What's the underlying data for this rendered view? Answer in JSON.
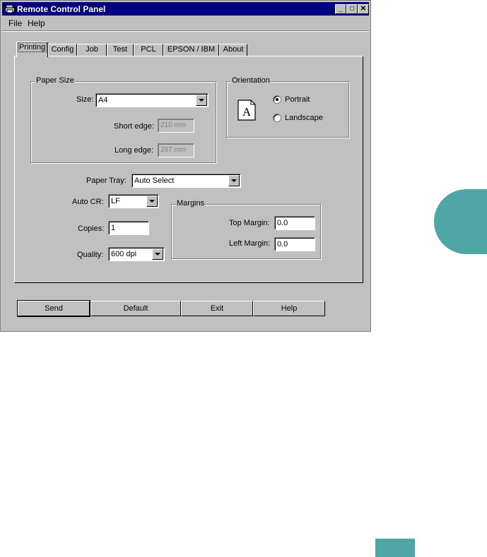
{
  "window": {
    "title": "Remote Control Panel",
    "minimize_label": "_",
    "maximize_label": "□",
    "close_label": "✕"
  },
  "menu": {
    "file": "File",
    "help": "Help"
  },
  "tabs": [
    {
      "label": "Printing",
      "active": true
    },
    {
      "label": "Config"
    },
    {
      "label": "Job"
    },
    {
      "label": "Test"
    },
    {
      "label": "PCL"
    },
    {
      "label": "EPSON / IBM"
    },
    {
      "label": "About"
    }
  ],
  "paper_size": {
    "group_label": "Paper Size",
    "size_label": "Size:",
    "size_value": "A4",
    "short_edge_label": "Short edge:",
    "short_edge_value": "210 mm",
    "long_edge_label": "Long edge:",
    "long_edge_value": "297 mm"
  },
  "orientation": {
    "group_label": "Orientation",
    "doc_icon_letter": "A",
    "portrait_label": "Portrait",
    "landscape_label": "Landscape",
    "selected": "Portrait"
  },
  "paper_tray": {
    "label": "Paper Tray:",
    "value": "Auto Select"
  },
  "auto_cr": {
    "label": "Auto CR:",
    "value": "LF"
  },
  "copies": {
    "label": "Copies:",
    "value": "1"
  },
  "quality": {
    "label": "Quality:",
    "value": "600 dpi"
  },
  "margins": {
    "group_label": "Margins",
    "top_label": "Top Margin:",
    "top_value": "0.0",
    "left_label": "Left Margin:",
    "left_value": "0.0"
  },
  "buttons": {
    "send": "Send",
    "default": "Default",
    "exit": "Exit",
    "help": "Help"
  },
  "colors": {
    "accent": "#4fa6a6",
    "titlebar": "#000080",
    "face": "#c0c0c0"
  }
}
